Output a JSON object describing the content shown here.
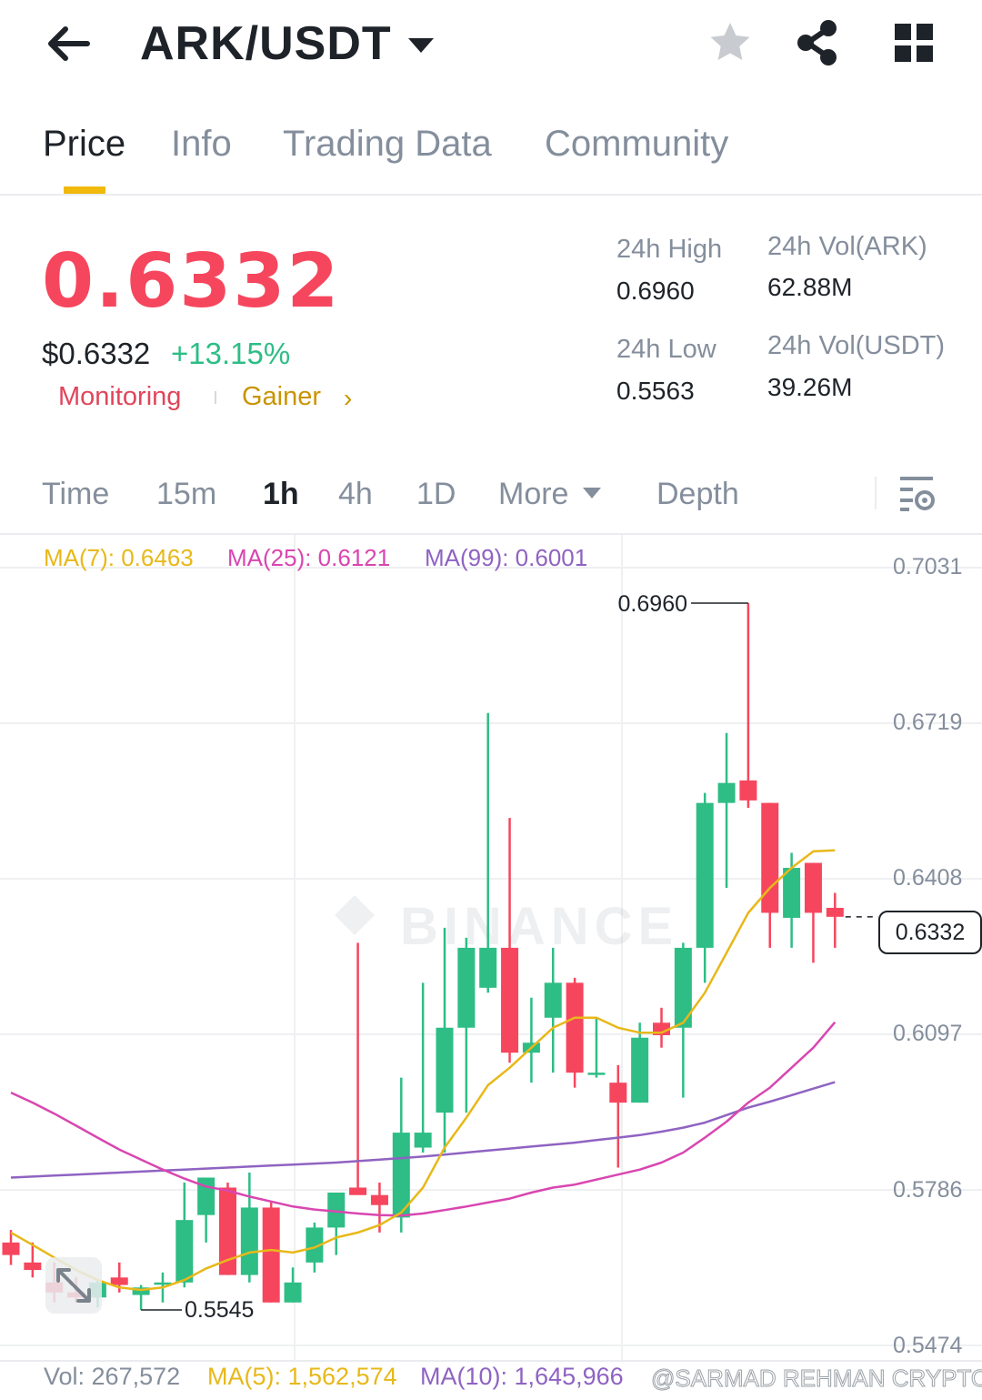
{
  "header": {
    "pair": "ARK/USDT",
    "icons": [
      "back-arrow-icon",
      "dropdown-caret-icon",
      "star-icon",
      "share-icon",
      "grid-menu-icon"
    ]
  },
  "tabs": [
    {
      "label": "Price",
      "active": true
    },
    {
      "label": "Info",
      "active": false
    },
    {
      "label": "Trading Data",
      "active": false
    },
    {
      "label": "Community",
      "active": false
    }
  ],
  "ticker": {
    "last_price": "0.6332",
    "usd_price": "$0.6332",
    "change_pct": "+13.15%",
    "tags": [
      "Monitoring",
      "Gainer"
    ],
    "stats": {
      "high_label": "24h High",
      "high_value": "0.6960",
      "low_label": "24h Low",
      "low_value": "0.5563",
      "vol_base_label": "24h Vol(ARK)",
      "vol_base_value": "62.88M",
      "vol_quote_label": "24h Vol(USDT)",
      "vol_quote_value": "39.26M"
    }
  },
  "intervals": [
    {
      "label": "Time",
      "active": false
    },
    {
      "label": "15m",
      "active": false
    },
    {
      "label": "1h",
      "active": true
    },
    {
      "label": "4h",
      "active": false
    },
    {
      "label": "1D",
      "active": false
    },
    {
      "label": "More",
      "active": false
    },
    {
      "label": "Depth",
      "active": false
    }
  ],
  "ma_legend": {
    "ma7": "MA(7): 0.6463",
    "ma25": "MA(25): 0.6121",
    "ma99": "MA(99): 0.6001"
  },
  "volume_legend": {
    "vol": "Vol: 267,572",
    "ma5": "MA(5): 1,562,574",
    "ma10": "MA(10): 1,645,966"
  },
  "watermark": "BINANCE",
  "credit": "@SARMAD REHMAN CRYPTO",
  "colors": {
    "up": "#2ebd85",
    "down": "#f6465d",
    "ma7": "#e8b819",
    "ma25": "#d946b0",
    "ma99": "#8f63c2",
    "accent": "#f0b90b"
  },
  "chart_data": {
    "type": "candlestick",
    "y_axis_ticks": [
      "0.7031",
      "0.6719",
      "0.6408",
      "0.6097",
      "0.5786",
      "0.5474"
    ],
    "ylim": [
      0.5474,
      0.7031
    ],
    "current_price_label": "0.6332",
    "high_marker": "0.6960",
    "low_marker": "0.5545",
    "candles": [
      {
        "o": 0.568,
        "h": 0.5705,
        "l": 0.5635,
        "c": 0.5655
      },
      {
        "o": 0.564,
        "h": 0.568,
        "l": 0.561,
        "c": 0.5625
      },
      {
        "o": 0.56,
        "h": 0.564,
        "l": 0.556,
        "c": 0.558
      },
      {
        "o": 0.558,
        "h": 0.561,
        "l": 0.556,
        "c": 0.557
      },
      {
        "o": 0.557,
        "h": 0.5605,
        "l": 0.555,
        "c": 0.56
      },
      {
        "o": 0.561,
        "h": 0.564,
        "l": 0.558,
        "c": 0.5595
      },
      {
        "o": 0.5575,
        "h": 0.5595,
        "l": 0.5545,
        "c": 0.559
      },
      {
        "o": 0.56,
        "h": 0.562,
        "l": 0.556,
        "c": 0.56
      },
      {
        "o": 0.56,
        "h": 0.58,
        "l": 0.559,
        "c": 0.5725
      },
      {
        "o": 0.5735,
        "h": 0.581,
        "l": 0.568,
        "c": 0.581
      },
      {
        "o": 0.579,
        "h": 0.58,
        "l": 0.5615,
        "c": 0.5615
      },
      {
        "o": 0.5615,
        "h": 0.582,
        "l": 0.56,
        "c": 0.575
      },
      {
        "o": 0.575,
        "h": 0.576,
        "l": 0.556,
        "c": 0.556
      },
      {
        "o": 0.556,
        "h": 0.563,
        "l": 0.556,
        "c": 0.56
      },
      {
        "o": 0.564,
        "h": 0.572,
        "l": 0.562,
        "c": 0.571
      },
      {
        "o": 0.571,
        "h": 0.577,
        "l": 0.5655,
        "c": 0.578
      },
      {
        "o": 0.579,
        "h": 0.628,
        "l": 0.578,
        "c": 0.5775
      },
      {
        "o": 0.5775,
        "h": 0.58,
        "l": 0.57,
        "c": 0.5755
      },
      {
        "o": 0.573,
        "h": 0.601,
        "l": 0.57,
        "c": 0.59
      },
      {
        "o": 0.587,
        "h": 0.62,
        "l": 0.586,
        "c": 0.59
      },
      {
        "o": 0.594,
        "h": 0.631,
        "l": 0.586,
        "c": 0.611
      },
      {
        "o": 0.611,
        "h": 0.629,
        "l": 0.594,
        "c": 0.627
      },
      {
        "o": 0.619,
        "h": 0.674,
        "l": 0.618,
        "c": 0.627
      },
      {
        "o": 0.627,
        "h": 0.653,
        "l": 0.604,
        "c": 0.606
      },
      {
        "o": 0.606,
        "h": 0.617,
        "l": 0.6,
        "c": 0.608
      },
      {
        "o": 0.613,
        "h": 0.627,
        "l": 0.602,
        "c": 0.62
      },
      {
        "o": 0.62,
        "h": 0.621,
        "l": 0.599,
        "c": 0.602
      },
      {
        "o": 0.602,
        "h": 0.613,
        "l": 0.601,
        "c": 0.602
      },
      {
        "o": 0.6,
        "h": 0.6035,
        "l": 0.583,
        "c": 0.596
      },
      {
        "o": 0.596,
        "h": 0.612,
        "l": 0.596,
        "c": 0.609
      },
      {
        "o": 0.612,
        "h": 0.615,
        "l": 0.607,
        "c": 0.6095
      },
      {
        "o": 0.611,
        "h": 0.628,
        "l": 0.597,
        "c": 0.627
      },
      {
        "o": 0.627,
        "h": 0.658,
        "l": 0.62,
        "c": 0.656
      },
      {
        "o": 0.656,
        "h": 0.67,
        "l": 0.639,
        "c": 0.66
      },
      {
        "o": 0.6605,
        "h": 0.696,
        "l": 0.655,
        "c": 0.6565
      },
      {
        "o": 0.656,
        "h": 0.656,
        "l": 0.627,
        "c": 0.634
      },
      {
        "o": 0.633,
        "h": 0.646,
        "l": 0.627,
        "c": 0.643
      },
      {
        "o": 0.644,
        "h": 0.644,
        "l": 0.624,
        "c": 0.634
      },
      {
        "o": 0.635,
        "h": 0.638,
        "l": 0.627,
        "c": 0.6332
      }
    ],
    "ma7": [
      0.57,
      0.5675,
      0.565,
      0.5625,
      0.5605,
      0.559,
      0.5585,
      0.559,
      0.5605,
      0.5628,
      0.5645,
      0.566,
      0.5665,
      0.566,
      0.567,
      0.569,
      0.57,
      0.5715,
      0.574,
      0.579,
      0.587,
      0.593,
      0.5995,
      0.603,
      0.607,
      0.611,
      0.613,
      0.613,
      0.611,
      0.61,
      0.61,
      0.612,
      0.618,
      0.626,
      0.634,
      0.639,
      0.643,
      0.6463,
      0.6465
    ],
    "ma25": [
      0.598,
      0.596,
      0.5938,
      0.5914,
      0.589,
      0.5866,
      0.5846,
      0.5826,
      0.5808,
      0.5792,
      0.5784,
      0.5772,
      0.5762,
      0.5752,
      0.5746,
      0.5742,
      0.5738,
      0.5735,
      0.5734,
      0.5738,
      0.5745,
      0.5752,
      0.576,
      0.5768,
      0.578,
      0.579,
      0.5796,
      0.5806,
      0.5816,
      0.5826,
      0.584,
      0.586,
      0.589,
      0.5922,
      0.596,
      0.599,
      0.603,
      0.607,
      0.6121
    ],
    "ma99": [
      0.581,
      0.5812,
      0.5814,
      0.5816,
      0.5818,
      0.582,
      0.5822,
      0.5824,
      0.5826,
      0.5828,
      0.583,
      0.5832,
      0.5834,
      0.5836,
      0.5838,
      0.584,
      0.5843,
      0.5846,
      0.5849,
      0.5852,
      0.5856,
      0.586,
      0.5864,
      0.5868,
      0.5872,
      0.5876,
      0.588,
      0.5885,
      0.589,
      0.5895,
      0.5902,
      0.591,
      0.592,
      0.5935,
      0.595,
      0.5962,
      0.5975,
      0.5988,
      0.6001
    ]
  }
}
